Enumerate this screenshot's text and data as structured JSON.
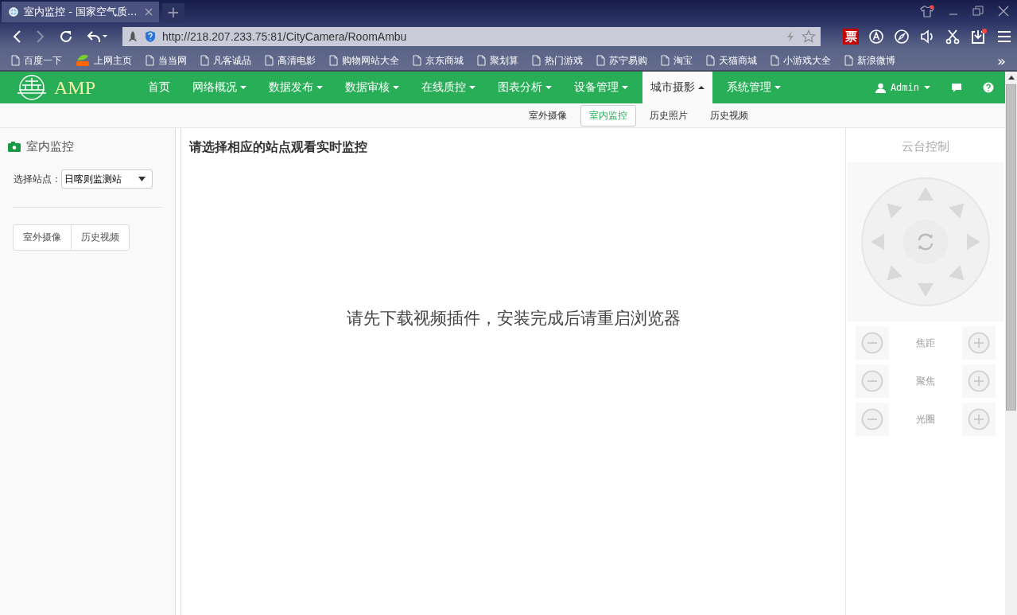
{
  "browser": {
    "tabs": [
      {
        "title": "室内监控 - 国家空气质...",
        "selected": true
      }
    ],
    "new_tab": "+",
    "url": "http://218.207.233.75:81/CityCamera/RoomAmbu",
    "ticket_label": "票",
    "bookmarks": [
      {
        "label": "百度一下",
        "kind": "page"
      },
      {
        "label": "上网主页",
        "kind": "logo"
      },
      {
        "label": "当当网",
        "kind": "page"
      },
      {
        "label": "凡客诚品",
        "kind": "page"
      },
      {
        "label": "高清电影",
        "kind": "page"
      },
      {
        "label": "购物网站大全",
        "kind": "page"
      },
      {
        "label": "京东商城",
        "kind": "page"
      },
      {
        "label": "聚划算",
        "kind": "page"
      },
      {
        "label": "热门游戏",
        "kind": "page"
      },
      {
        "label": "苏宁易购",
        "kind": "page"
      },
      {
        "label": "淘宝",
        "kind": "page"
      },
      {
        "label": "天猫商城",
        "kind": "page"
      },
      {
        "label": "小游戏大全",
        "kind": "page"
      },
      {
        "label": "新浪微博",
        "kind": "page"
      }
    ],
    "more": "»"
  },
  "nav": {
    "logo_text": "AMP",
    "items": [
      {
        "label": "首页",
        "dropdown": false,
        "selected": false
      },
      {
        "label": "网络概况",
        "dropdown": true,
        "selected": false
      },
      {
        "label": "数据发布",
        "dropdown": true,
        "selected": false
      },
      {
        "label": "数据审核",
        "dropdown": true,
        "selected": false
      },
      {
        "label": "在线质控",
        "dropdown": true,
        "selected": false
      },
      {
        "label": "图表分析",
        "dropdown": true,
        "selected": false
      },
      {
        "label": "设备管理",
        "dropdown": true,
        "selected": false
      },
      {
        "label": "城市摄影",
        "dropdown": true,
        "selected": true
      },
      {
        "label": "系统管理",
        "dropdown": true,
        "selected": false
      }
    ],
    "user": "Admin"
  },
  "subnav": [
    {
      "label": "室外摄像",
      "selected": false
    },
    {
      "label": "室内监控",
      "selected": true
    },
    {
      "label": "历史照片",
      "selected": false
    },
    {
      "label": "历史视频",
      "selected": false
    }
  ],
  "sidebar": {
    "title": "室内监控",
    "station_label": "选择站点：",
    "station_value": "日喀则监测站",
    "buttons": [
      "室外摄像",
      "历史视频"
    ]
  },
  "main": {
    "heading": "请选择相应的站点观看实时监控",
    "message": "请先下载视频插件，安装完成后请重启浏览器"
  },
  "ptz": {
    "title": "云台控制",
    "rows": [
      {
        "label": "焦距"
      },
      {
        "label": "聚焦"
      },
      {
        "label": "光圈"
      }
    ]
  }
}
